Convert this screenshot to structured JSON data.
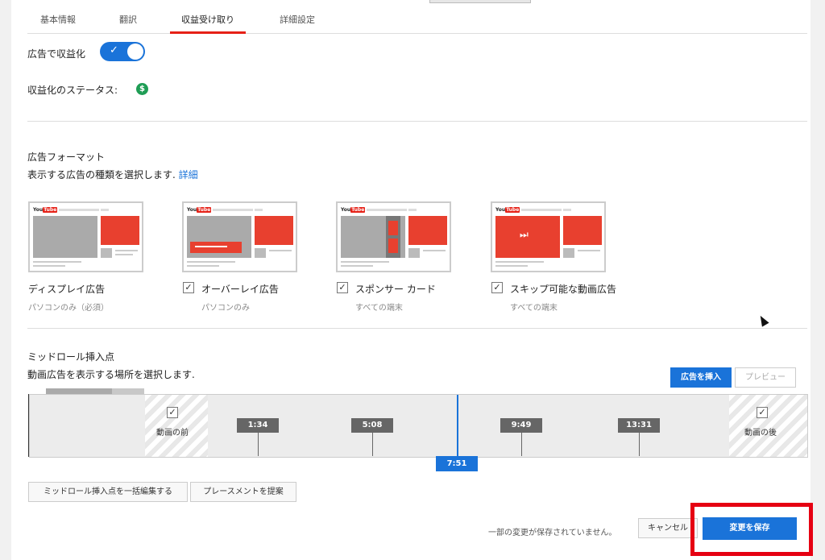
{
  "tabs": [
    {
      "label": "基本情報",
      "active": false
    },
    {
      "label": "翻訳",
      "active": false
    },
    {
      "label": "収益受け取り",
      "active": true
    },
    {
      "label": "詳細設定",
      "active": false
    }
  ],
  "monetization": {
    "label": "広告で収益化",
    "enabled": true,
    "status_label": "収益化のステータス:",
    "status_icon": "dollar-icon",
    "status_icon_char": "$"
  },
  "ad_formats": {
    "title": "広告フォーマット",
    "description": "表示する広告の種類を選択します.",
    "more_link": "詳細",
    "items": [
      {
        "name": "ディスプレイ広告",
        "sub": "パソコンのみ（必須）",
        "checkable": false,
        "checked": true
      },
      {
        "name": "オーバーレイ広告",
        "sub": "パソコンのみ",
        "checkable": true,
        "checked": true
      },
      {
        "name": "スポンサー カード",
        "sub": "すべての端末",
        "checkable": true,
        "checked": true
      },
      {
        "name": "スキップ可能な動画広告",
        "sub": "すべての端末",
        "checkable": true,
        "checked": true
      }
    ]
  },
  "midroll": {
    "title": "ミッドロール挿入点",
    "description": "動画広告を表示する場所を選択します.",
    "insert_button": "広告を挿入",
    "preview_button": "プレビュー",
    "before_label": "動画の前",
    "after_label": "動画の後",
    "markers": [
      "1:34",
      "5:08",
      "9:49",
      "13:31"
    ],
    "playhead": "7:51",
    "bulk_edit_button": "ミッドロール挿入点を一括編集する",
    "suggest_button": "プレースメントを提案"
  },
  "footer": {
    "unsaved_text": "一部の変更が保存されていません。",
    "cancel_button": "キャンセル",
    "save_button": "変更を保存"
  },
  "colors": {
    "accent": "#1a73d9",
    "brand_red": "#e62117",
    "highlight": "#e60012"
  }
}
